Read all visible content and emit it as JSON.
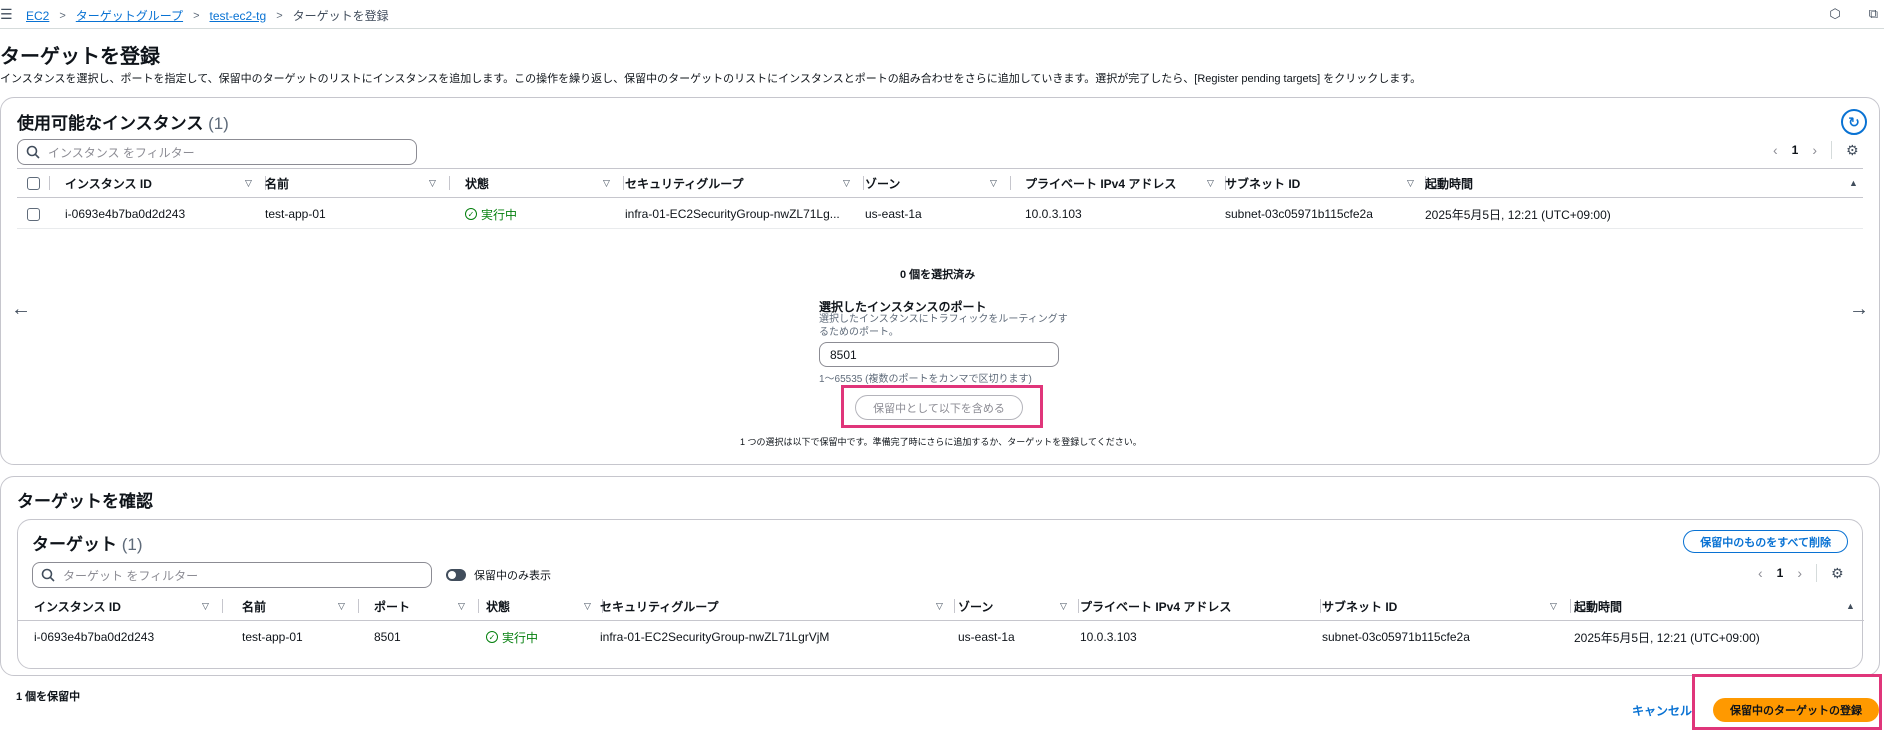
{
  "breadcrumb": {
    "items": [
      {
        "label": "EC2"
      },
      {
        "label": "ターゲットグループ"
      },
      {
        "label": "test-ec2-tg"
      }
    ],
    "current": "ターゲットを登録"
  },
  "page": {
    "title": "ターゲットを登録",
    "description": "インスタンスを選択し、ポートを指定して、保留中のターゲットのリストにインスタンスを追加します。この操作を繰り返し、保留中のターゲットのリストにインスタンスとポートの組み合わせをさらに追加していきます。選択が完了したら、[Register pending targets] をクリックします。"
  },
  "available": {
    "title": "使用可能なインスタンス",
    "count": "(1)",
    "filter_placeholder": "インスタンス をフィルター",
    "page_number": "1",
    "columns": [
      "インスタンス ID",
      "名前",
      "状態",
      "セキュリティグループ",
      "ゾーン",
      "プライベート IPv4 アドレス",
      "サブネット ID",
      "起動時間"
    ],
    "rows": [
      {
        "instance_id": "i-0693e4b7ba0d2d243",
        "name": "test-app-01",
        "state": "実行中",
        "security_group": "infra-01-EC2SecurityGroup-nwZL71Lg...",
        "zone": "us-east-1a",
        "private_ip": "10.0.3.103",
        "subnet_id": "subnet-03c05971b115cfe2a",
        "launch_time": "2025年5月5日, 12:21 (UTC+09:00)"
      }
    ],
    "selected_count": "0 個を選択済み",
    "port_label": "選択したインスタンスのポート",
    "port_description": "選択したインスタンスにトラフィックをルーティングするためのポート。",
    "port_value": "8501",
    "port_hint": "1〜65535 (複数のポートをカンマで区切ります)",
    "include_button": "保留中として以下を含める",
    "pending_note": "1 つの選択は以下で保留中です。準備完了時にさらに追加するか、ターゲットを登録してください。"
  },
  "review": {
    "title": "ターゲットを確認",
    "targets_title": "ターゲット",
    "targets_count": "(1)",
    "remove_all": "保留中のものをすべて削除",
    "filter_placeholder": "ターゲット をフィルター",
    "toggle_label": "保留中のみ表示",
    "page_number": "1",
    "columns": [
      "インスタンス ID",
      "名前",
      "ポート",
      "状態",
      "セキュリティグループ",
      "ゾーン",
      "プライベート IPv4 アドレス",
      "サブネット ID",
      "起動時間"
    ],
    "rows": [
      {
        "instance_id": "i-0693e4b7ba0d2d243",
        "name": "test-app-01",
        "port": "8501",
        "state": "実行中",
        "security_group": "infra-01-EC2SecurityGroup-nwZL71LgrVjM",
        "zone": "us-east-1a",
        "private_ip": "10.0.3.103",
        "subnet_id": "subnet-03c05971b115cfe2a",
        "launch_time": "2025年5月5日, 12:21 (UTC+09:00)"
      }
    ]
  },
  "footer": {
    "pending_count": "1 個を保留中",
    "cancel": "キャンセル",
    "register": "保留中のターゲットの登録"
  },
  "colors": {
    "link": "#0972d3",
    "success": "#037f0c",
    "primary_button": "#ff9900",
    "highlight": "#e0357a"
  },
  "icons": [
    "menu-icon",
    "search-icon",
    "refresh-icon",
    "gear-icon",
    "chevron-left-icon",
    "chevron-right-icon",
    "arrow-left-icon",
    "arrow-right-icon",
    "status-success-icon",
    "settings-icon",
    "external-icon"
  ]
}
